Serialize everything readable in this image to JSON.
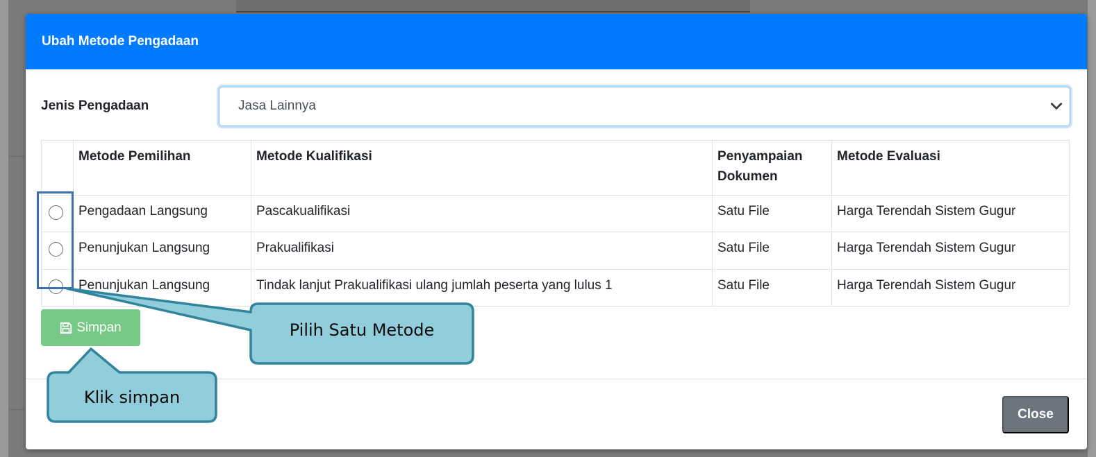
{
  "modal": {
    "title": "Ubah Metode Pengadaan",
    "jenis_label": "Jenis Pengadaan",
    "jenis_value": "Jasa Lainnya",
    "table": {
      "headers": [
        "",
        "Metode Pemilihan",
        "Metode Kualifikasi",
        "Penyampaian Dokumen",
        "Metode Evaluasi"
      ],
      "rows": [
        {
          "pemilihan": "Pengadaan Langsung",
          "kualifikasi": "Pascakualifikasi",
          "penyampaian": "Satu File",
          "evaluasi": "Harga Terendah Sistem Gugur"
        },
        {
          "pemilihan": "Penunjukan Langsung",
          "kualifikasi": "Prakualifikasi",
          "penyampaian": "Satu File",
          "evaluasi": "Harga Terendah Sistem Gugur"
        },
        {
          "pemilihan": "Penunjukan Langsung",
          "kualifikasi": "Tindak lanjut Prakualifikasi ulang jumlah peserta yang lulus 1",
          "penyampaian": "Satu File",
          "evaluasi": "Harga Terendah Sistem Gugur"
        }
      ]
    },
    "simpan_label": "Simpan",
    "close_label": "Close"
  },
  "annotations": {
    "pilih_metode": "Pilih Satu Metode",
    "klik_simpan": "Klik simpan"
  },
  "colors": {
    "header_blue": "#007bff",
    "simpan_green": "#77c987",
    "close_gray": "#6c757d",
    "callout_fill": "#92cddc",
    "callout_border": "#31849b",
    "highlight_border": "#3d6eb4"
  }
}
